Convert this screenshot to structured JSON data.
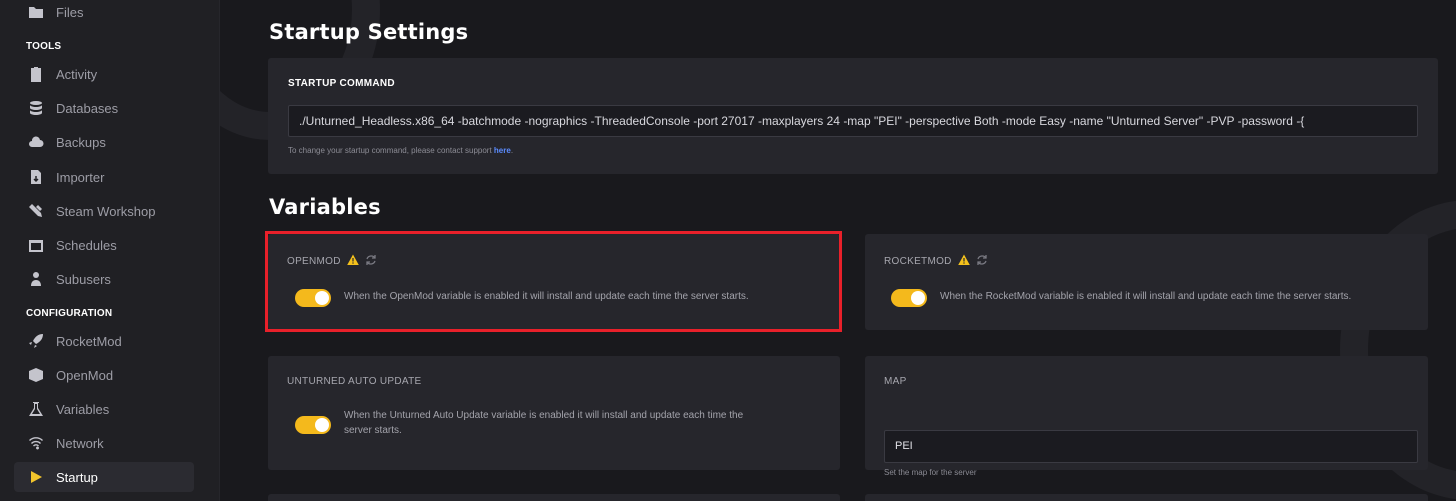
{
  "sidebar": {
    "top_item": {
      "label": "Files",
      "icon": "folder-icon"
    },
    "tools_label": "TOOLS",
    "tools": [
      {
        "label": "Activity",
        "icon": "clipboard-icon"
      },
      {
        "label": "Databases",
        "icon": "database-icon"
      },
      {
        "label": "Backups",
        "icon": "cloud-icon"
      },
      {
        "label": "Importer",
        "icon": "file-import-icon"
      },
      {
        "label": "Steam Workshop",
        "icon": "tools-icon"
      },
      {
        "label": "Schedules",
        "icon": "calendar-icon"
      },
      {
        "label": "Subusers",
        "icon": "user-icon"
      }
    ],
    "config_label": "CONFIGURATION",
    "config": [
      {
        "label": "RocketMod",
        "icon": "rocket-icon"
      },
      {
        "label": "OpenMod",
        "icon": "cube-icon"
      },
      {
        "label": "Variables",
        "icon": "flask-icon"
      },
      {
        "label": "Network",
        "icon": "wifi-icon"
      },
      {
        "label": "Startup",
        "icon": "play-icon",
        "active": true
      }
    ]
  },
  "startup": {
    "title": "Startup Settings",
    "command_label": "STARTUP COMMAND",
    "command_value": "./Unturned_Headless.x86_64 -batchmode -nographics -ThreadedConsole -port 27017 -maxplayers 24 -map \"PEI\" -perspective Both -mode Easy -name \"Unturned Server\" -PVP -password  -{",
    "hint_text": "To change your startup command, please contact support ",
    "hint_link": "here",
    "hint_end": "."
  },
  "variables": {
    "title": "Variables",
    "openmod": {
      "label": "OPENMOD",
      "description": "When the OpenMod variable is enabled it will install and update each time the server starts.",
      "enabled": true
    },
    "rocketmod": {
      "label": "ROCKETMOD",
      "description": "When the RocketMod variable is enabled it will install and update each time the server starts.",
      "enabled": true
    },
    "autoupdate": {
      "label": "UNTURNED AUTO UPDATE",
      "description_line1": "When the Unturned Auto Update variable is enabled it will install and update each time the",
      "description_line2": "server starts.",
      "enabled": true
    },
    "map": {
      "label": "MAP",
      "value": "PEI",
      "hint": "Set the map for the server"
    }
  },
  "colors": {
    "accent": "#f4b91c",
    "highlight": "#e8202a",
    "link": "#5b8cff"
  }
}
